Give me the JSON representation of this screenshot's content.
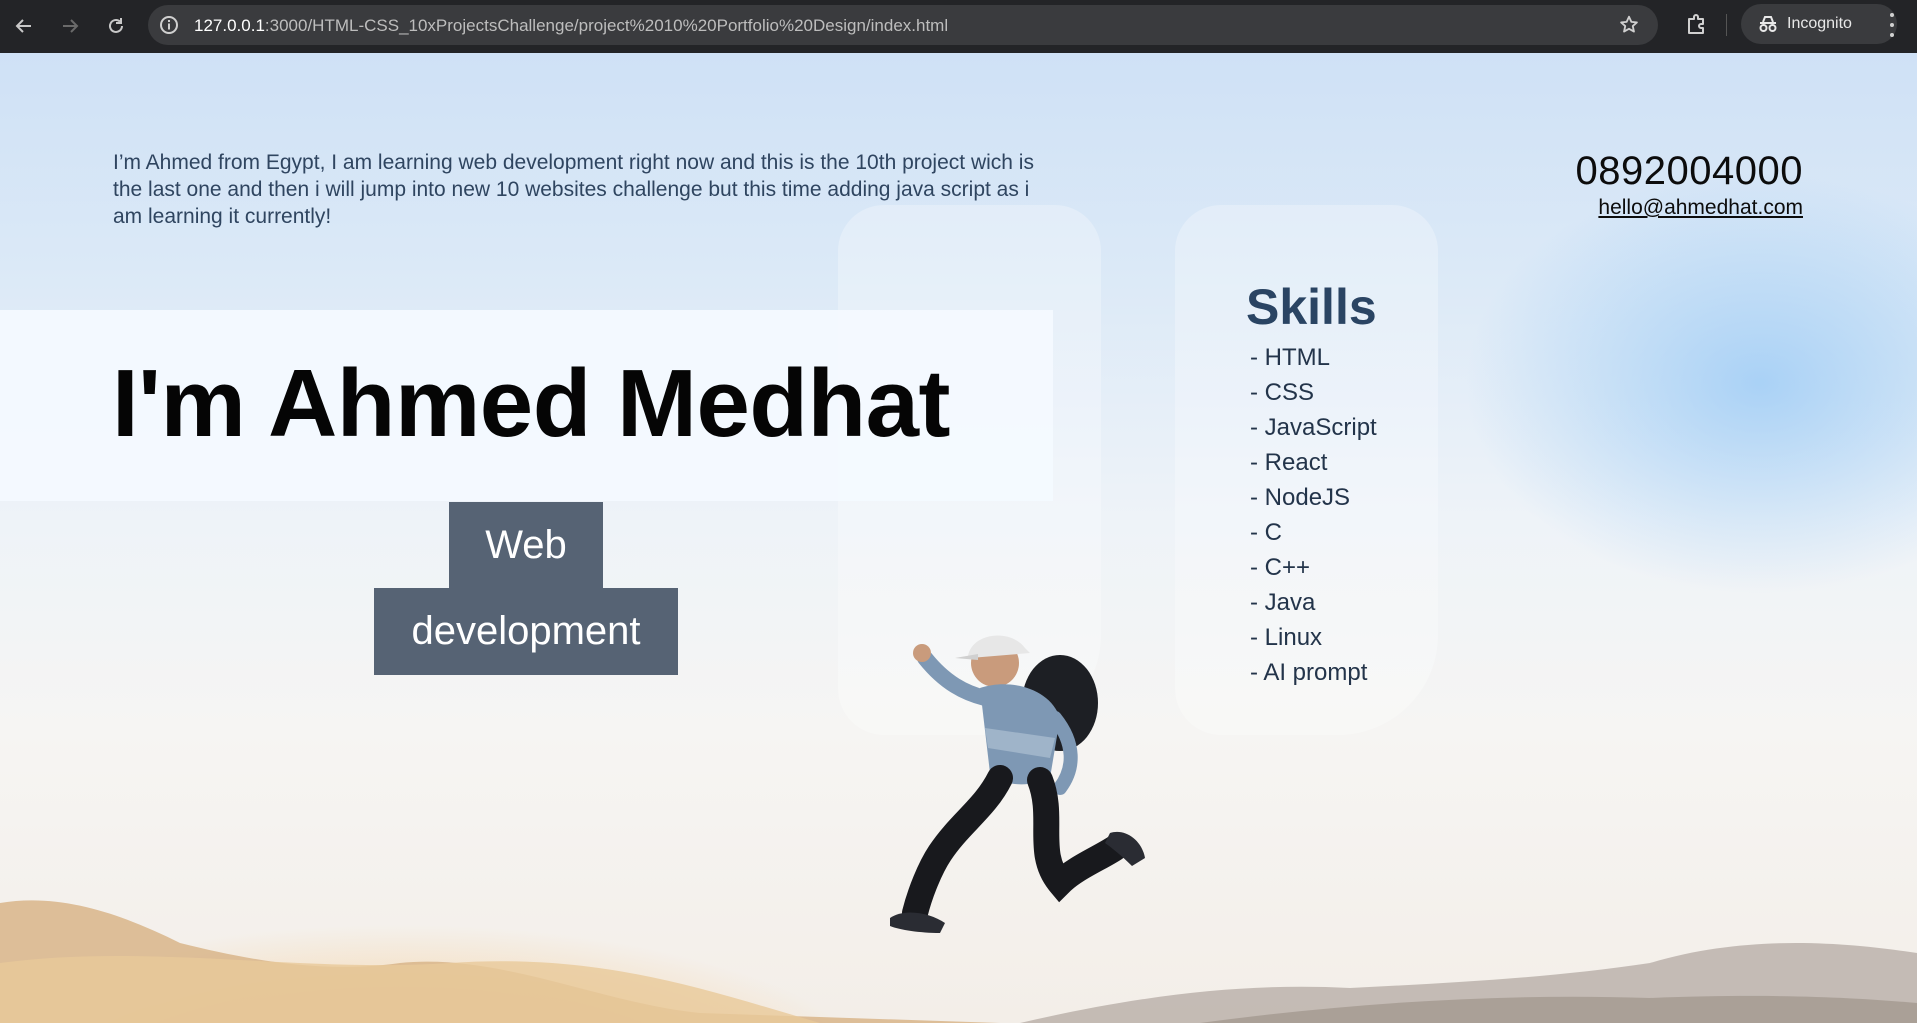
{
  "browser": {
    "url_host": "127.0.0.1",
    "url_path": ":3000/HTML-CSS_10xProjectsChallenge/project%2010%20Portfolio%20Design/index.html",
    "mode_label": "Incognito"
  },
  "page": {
    "intro": "I’m Ahmed from Egypt, I am learning web development right now and this is the 10th project wich is the last one and then i will jump into new 10 websites challenge but this time adding java script as i am learning it currently!",
    "phone": "0892004000",
    "email": "hello@ahmedhat.com",
    "hero_title": "I'm Ahmed Medhat",
    "tag_line1": "Web",
    "tag_line2": "development",
    "skills_title": "Skills",
    "skills": [
      "- HTML",
      "- CSS",
      "- JavaScript",
      "- React",
      "- NodeJS",
      "- C",
      "- C++",
      "- Java",
      "- Linux",
      "- AI prompt"
    ]
  },
  "colors": {
    "chrome_bg": "#232427",
    "tag_bg": "#566374",
    "skills_title": "#2a4463"
  }
}
